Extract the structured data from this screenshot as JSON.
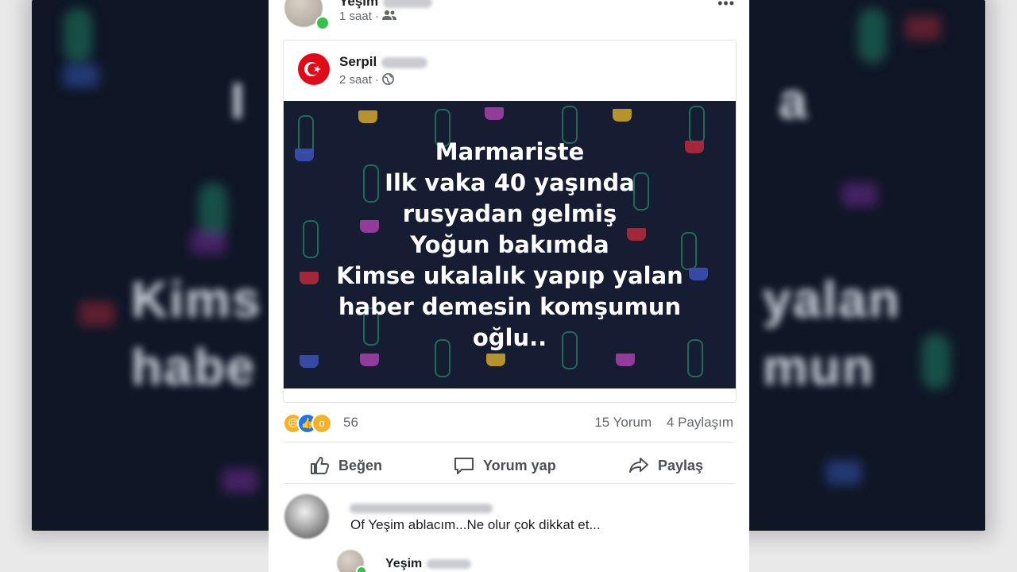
{
  "post": {
    "author_name": "Yeşim",
    "time": "1 saat",
    "audience_icon": "friends-icon",
    "more_icon": "•••"
  },
  "shared_post": {
    "author_name": "Serpil",
    "time": "2 saat",
    "audience_icon": "globe-icon",
    "image_text_lines": [
      "Marmariste",
      "Ilk vaka 40 yaşında",
      "rusyadan gelmiş",
      "Yoğun bakımda",
      "Kimse ukalalık yapıp yalan",
      "haber demesin komşumun",
      "oğlu.."
    ]
  },
  "reactions": {
    "count": "56",
    "comments": "15 Yorum",
    "shares": "4 Paylaşım"
  },
  "actions": {
    "like": "Beğen",
    "comment": "Yorum yap",
    "share": "Paylaş"
  },
  "comment": {
    "text": "Of Yeşim ablacım...Ne olur çok dikkat et..."
  },
  "reply": {
    "author_name": "Yeşim"
  },
  "backdrop": {
    "line1": "Kims",
    "line1b": "yalan",
    "line2": "habe",
    "line2b": "mun",
    "top_left": "I",
    "top_right": "a"
  },
  "colors": {
    "image_bg": "#161d33",
    "online": "#36c24a",
    "flag_red": "#e30a17",
    "like_blue": "#1877f2"
  }
}
